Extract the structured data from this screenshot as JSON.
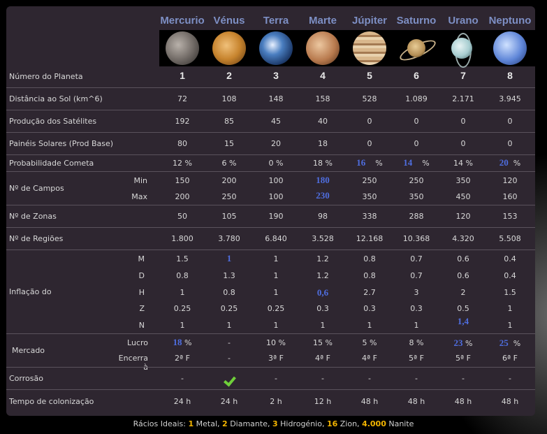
{
  "planets": [
    "Mercurio",
    "Vénus",
    "Terra",
    "Marte",
    "Júpiter",
    "Saturno",
    "Urano",
    "Neptuno"
  ],
  "rows": {
    "numero": {
      "label": "Número do Planeta",
      "values": [
        "1",
        "2",
        "3",
        "4",
        "5",
        "6",
        "7",
        "8"
      ]
    },
    "distancia": {
      "label": "Distância ao Sol (km^6)",
      "values": [
        "72",
        "108",
        "148",
        "158",
        "528",
        "1.089",
        "2.171",
        "3.945"
      ]
    },
    "producao": {
      "label": "Produção dos Satélites",
      "values": [
        "192",
        "85",
        "45",
        "40",
        "0",
        "0",
        "0",
        "0"
      ]
    },
    "paineis": {
      "label": "Painéis Solares (Prod Base)",
      "values": [
        "80",
        "15",
        "20",
        "18",
        "0",
        "0",
        "0",
        "0"
      ]
    },
    "cometa": {
      "label": "Probabilidade Cometa",
      "values": [
        "12 %",
        "6 %",
        "0 %",
        "18 %",
        "16",
        "14",
        "14 %",
        "20"
      ],
      "pct": "%"
    },
    "campos": {
      "label": "Nº de Campos",
      "min_label": "Min",
      "max_label": "Max",
      "min": [
        "150",
        "200",
        "100",
        "180",
        "250",
        "250",
        "350",
        "120"
      ],
      "max": [
        "200",
        "250",
        "100",
        "230",
        "350",
        "350",
        "450",
        "160"
      ]
    },
    "zonas": {
      "label": "Nº de Zonas",
      "values": [
        "50",
        "105",
        "190",
        "98",
        "338",
        "288",
        "120",
        "153"
      ]
    },
    "regioes": {
      "label": "Nº de Regiões",
      "values": [
        "1.800",
        "3.780",
        "6.840",
        "3.528",
        "12.168",
        "10.368",
        "4.320",
        "5.508"
      ]
    },
    "inflacao": {
      "label": "Inflação do",
      "sub": [
        "M",
        "D",
        "H",
        "Z",
        "N"
      ],
      "M": [
        "1.5",
        "1",
        "1",
        "1.2",
        "0.8",
        "0.7",
        "0.6",
        "0.4"
      ],
      "D": [
        "0.8",
        "1.3",
        "1",
        "1.2",
        "0.8",
        "0.7",
        "0.6",
        "0.4"
      ],
      "H": [
        "1",
        "0.8",
        "1",
        "0,6",
        "2.7",
        "3",
        "2",
        "1.5"
      ],
      "Z": [
        "0.25",
        "0.25",
        "0.25",
        "0.3",
        "0.3",
        "0.3",
        "0.5",
        "1"
      ],
      "N": [
        "1",
        "1",
        "1",
        "1",
        "1",
        "1",
        "1,4",
        "1"
      ]
    },
    "mercado": {
      "label": "Mercado",
      "lucro_label": "Lucro",
      "encerra_label": "Encerra à",
      "lucro": [
        "18",
        "-",
        "10 %",
        "15 %",
        "5 %",
        "8 %",
        "23",
        "25"
      ],
      "encerra": [
        "2ª F",
        "-",
        "3ª F",
        "4ª F",
        "4ª F",
        "5ª F",
        "5ª F",
        "6ª F"
      ]
    },
    "corrosao": {
      "label": "Corrosão",
      "values": [
        "-",
        "",
        "-",
        "-",
        "-",
        "-",
        "-",
        "-"
      ]
    },
    "tempo": {
      "label": "Tempo de colonização",
      "values": [
        "24 h",
        "24 h",
        "2 h",
        "12 h",
        "48 h",
        "48 h",
        "48 h",
        "48 h"
      ]
    }
  },
  "footer": {
    "prefix": "Rácios Ideais:",
    "n1": "1",
    "t1": "Metal,",
    "n2": "2",
    "t2": "Diamante,",
    "n3": "3",
    "t3": "Hidrogénio,",
    "n4": "16",
    "t4": "Zion,",
    "n5": "4.000",
    "t5": "Nanite"
  }
}
